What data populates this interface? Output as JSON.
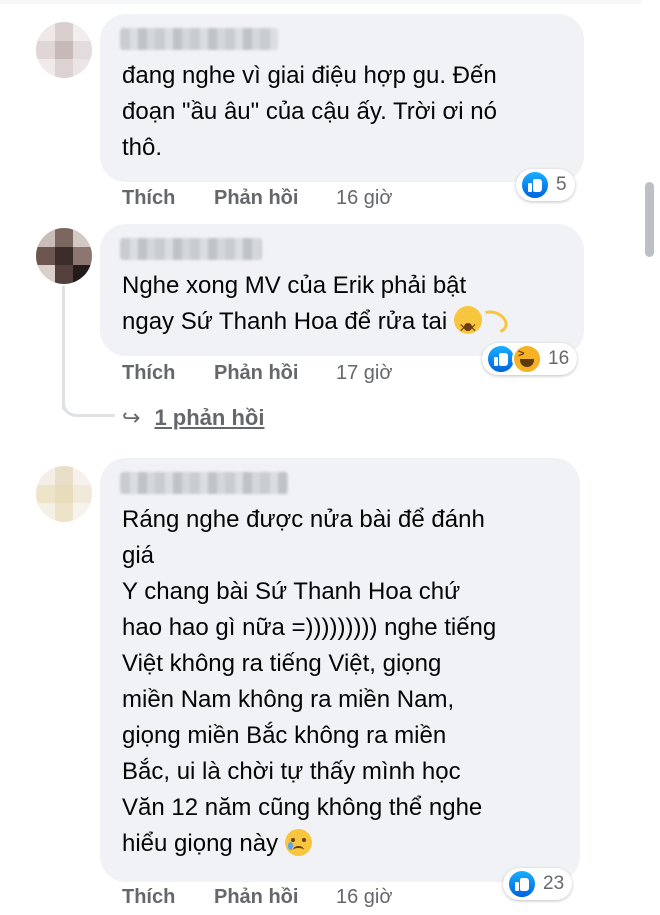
{
  "comments": [
    {
      "text": "đang nghe vì giai điệu hợp gu. Đến\nđoạn \"ầu âu\" của cậu ấy. Trời ơi nó\nthô.",
      "actions": {
        "like": "Thích",
        "reply": "Phản hồi",
        "time": "16 giờ"
      },
      "reaction_count": "5",
      "reactions": [
        "like-icon"
      ]
    },
    {
      "text_line1": "Nghe xong MV của Erik phải bật",
      "text_line2": "ngay Sứ Thanh Hoa để rửa tai",
      "actions": {
        "like": "Thích",
        "reply": "Phản hồi",
        "time": "17 giờ"
      },
      "reaction_count": "16",
      "reactions": [
        "like-icon",
        "haha-icon"
      ],
      "replies_link": "1 phản hồi"
    },
    {
      "text": "Ráng nghe được nửa bài để đánh\ngiá\nY chang bài Sứ Thanh Hoa chứ\nhao hao gì nữa =))))))))) nghe tiếng\nViệt không ra tiếng Việt, giọng\nmiền Nam không ra miền Nam,\ngiọng miền Bắc không ra miền\nBắc, ui là chời tự thấy mình học\nVăn 12 năm cũng không thể nghe",
      "text_last": "hiểu giọng này",
      "actions": {
        "like": "Thích",
        "reply": "Phản hồi",
        "time": "16 giờ"
      },
      "reaction_count": "23",
      "reactions": [
        "like-icon"
      ]
    }
  ],
  "colors": {
    "bubble": "#f0f2f5",
    "secondary_text": "#65676b",
    "like_blue": "#0866ff"
  }
}
